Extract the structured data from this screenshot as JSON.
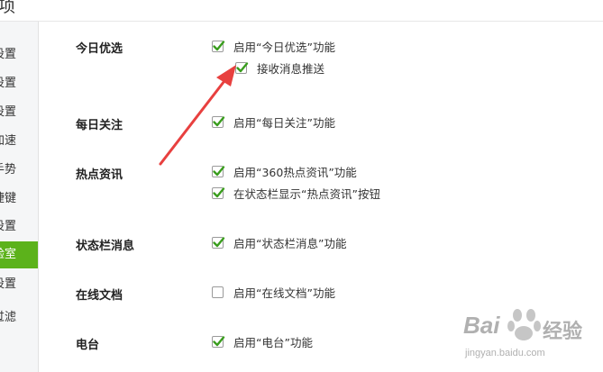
{
  "header": {
    "title": "项"
  },
  "sidebar": {
    "items": [
      {
        "label": "设置",
        "active": false
      },
      {
        "label": "设置",
        "active": false
      },
      {
        "label": "设置",
        "active": false
      },
      {
        "label": "加速",
        "active": false
      },
      {
        "label": "手势",
        "active": false
      },
      {
        "label": "捷键",
        "active": false
      },
      {
        "label": "设置",
        "active": false
      },
      {
        "label": "验室",
        "active": true
      },
      {
        "label": "设置",
        "active": false
      },
      {
        "label": "过滤",
        "active": false
      }
    ]
  },
  "sections": [
    {
      "title": "今日优选",
      "options": [
        {
          "label": "启用“今日优选”功能",
          "checked": true
        },
        {
          "label": "接收消息推送",
          "checked": true
        }
      ]
    },
    {
      "title": "每日关注",
      "options": [
        {
          "label": "启用“每日关注”功能",
          "checked": true
        }
      ]
    },
    {
      "title": "热点资讯",
      "options": [
        {
          "label": "启用“360热点资讯”功能",
          "checked": true
        },
        {
          "label": "在状态栏显示“热点资讯”按钮",
          "checked": true
        }
      ]
    },
    {
      "title": "状态栏消息",
      "options": [
        {
          "label": "启用“状态栏消息”功能",
          "checked": true
        }
      ]
    },
    {
      "title": "在线文档",
      "options": [
        {
          "label": "启用“在线文档”功能",
          "checked": false
        }
      ]
    },
    {
      "title": "电台",
      "options": [
        {
          "label": "启用“电台”功能",
          "checked": true
        }
      ]
    }
  ],
  "colors": {
    "accent": "#5cb21b",
    "check": "#3a9d1e",
    "arrow": "#e8403f"
  },
  "watermark": {
    "brand": "Bai",
    "brand2": "经验",
    "url": "jingyan.baidu.com"
  }
}
